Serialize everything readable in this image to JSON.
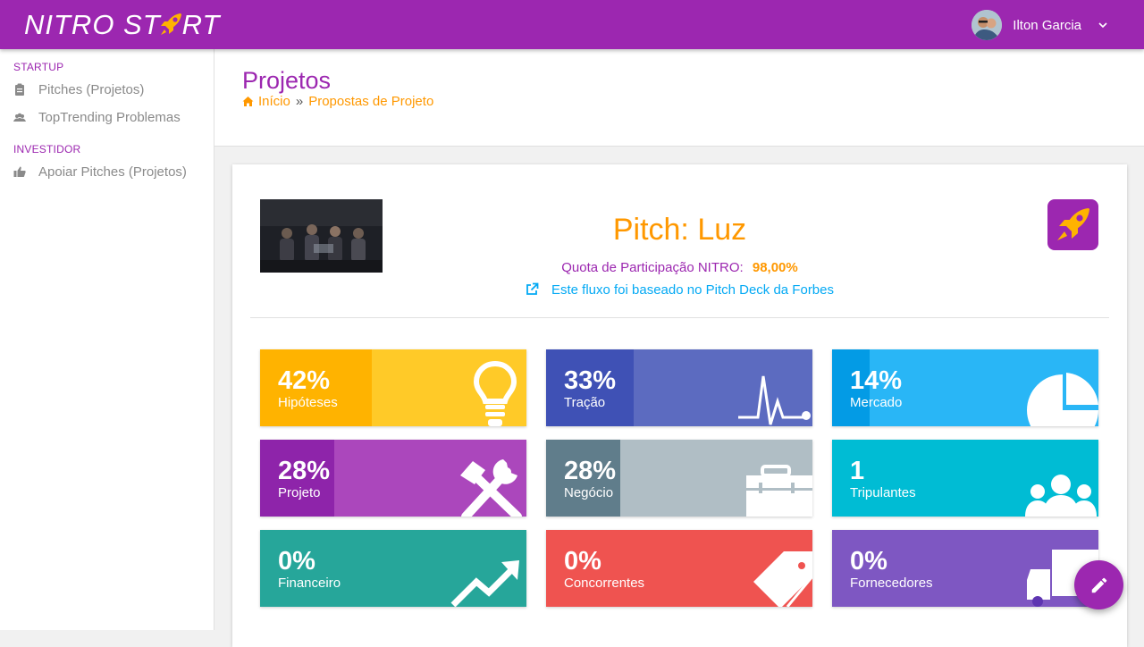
{
  "header": {
    "brand_left": "NITRO ST",
    "brand_right": "RT",
    "user_name": "Ilton Garcia"
  },
  "sidebar": {
    "section_startup": "STARTUP",
    "section_investor": "INVESTIDOR",
    "items": [
      {
        "label": "Pitches (Projetos)",
        "icon": "clipboard-icon"
      },
      {
        "label": "TopTrending Problemas",
        "icon": "users-icon"
      },
      {
        "label": "Apoiar Pitches (Projetos)",
        "icon": "thumbs-up-icon"
      }
    ]
  },
  "page": {
    "title": "Projetos",
    "breadcrumb": {
      "home": "Início",
      "separator": "»",
      "current": "Propostas de Projeto"
    }
  },
  "pitch": {
    "title": "Pitch: Luz",
    "quota_label": "Quota de Participação NITRO:",
    "quota_value": "98,00%",
    "forbes_link": "Este fluxo foi baseado no Pitch Deck da Forbes"
  },
  "tiles": [
    {
      "pct": "42%",
      "label": "Hipóteses",
      "progress": 0.42,
      "bg": "#ffca28",
      "fill": "#ffb300",
      "icon": "lightbulb-icon"
    },
    {
      "pct": "33%",
      "label": "Tração",
      "progress": 0.33,
      "bg": "#5c6bc0",
      "fill": "#3f51b5",
      "icon": "pulse-icon"
    },
    {
      "pct": "14%",
      "label": "Mercado",
      "progress": 0.14,
      "bg": "#29b6f6",
      "fill": "#039be5",
      "icon": "pie-chart-icon"
    },
    {
      "pct": "28%",
      "label": "Projeto",
      "progress": 0.28,
      "bg": "#ab47bc",
      "fill": "#8e24aa",
      "icon": "tools-icon"
    },
    {
      "pct": "28%",
      "label": "Negócio",
      "progress": 0.28,
      "bg": "#b0bec5",
      "fill": "#607d8b",
      "icon": "briefcase-icon"
    },
    {
      "pct": "1",
      "label": "Tripulantes",
      "progress": 0,
      "bg": "#00bcd4",
      "fill": "#00acc1",
      "icon": "team-icon"
    },
    {
      "pct": "0%",
      "label": "Financeiro",
      "progress": 0,
      "bg": "#26a69a",
      "fill": "#00897b",
      "icon": "trend-up-icon"
    },
    {
      "pct": "0%",
      "label": "Concorrentes",
      "progress": 0,
      "bg": "#ef5350",
      "fill": "#e53935",
      "icon": "tag-icon"
    },
    {
      "pct": "0%",
      "label": "Fornecedores",
      "progress": 0,
      "bg": "#7e57c2",
      "fill": "#5e35b1",
      "icon": "truck-icon"
    }
  ]
}
